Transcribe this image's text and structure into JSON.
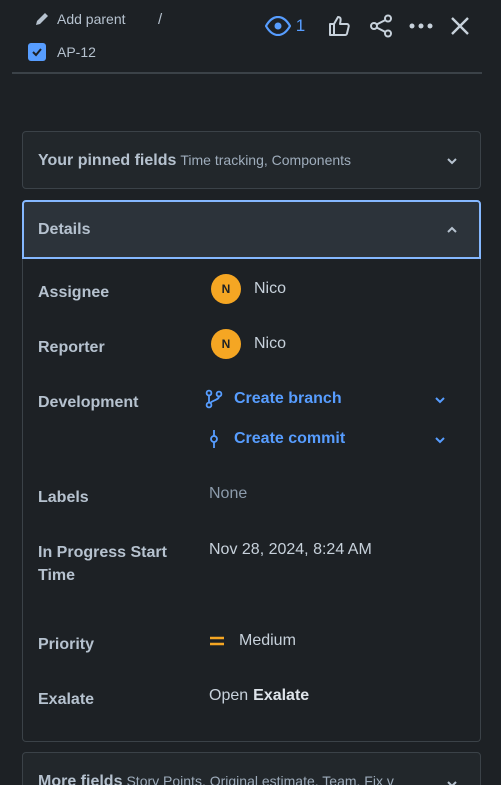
{
  "breadcrumb": {
    "add_parent": "Add parent",
    "separator": "/",
    "issue_key": "AP-12"
  },
  "actions": {
    "watch_count": "1"
  },
  "pinned": {
    "title": "Your pinned fields",
    "subtitle": "Time tracking, Components"
  },
  "details": {
    "title": "Details",
    "fields": {
      "assignee_label": "Assignee",
      "assignee_initial": "N",
      "assignee_name": "Nico",
      "reporter_label": "Reporter",
      "reporter_initial": "N",
      "reporter_name": "Nico",
      "development_label": "Development",
      "create_branch": "Create branch",
      "create_commit": "Create commit",
      "labels_label": "Labels",
      "labels_value": "None",
      "in_progress_label_1": "In Progress Start",
      "in_progress_label_2": "Time",
      "in_progress_value": "Nov 28, 2024, 8:24 AM",
      "priority_label": "Priority",
      "priority_value": "Medium",
      "exalate_label": "Exalate",
      "exalate_open": "Open",
      "exalate_name": "Exalate"
    }
  },
  "more": {
    "title": "More fields",
    "subtitle": "Story Points, Original estimate, Team, Fix v"
  },
  "colors": {
    "background": "#1d2125",
    "accent": "#579dff",
    "avatar": "#f5a623",
    "priority_medium": "#f5a623",
    "focus_border": "#85b8ff"
  }
}
